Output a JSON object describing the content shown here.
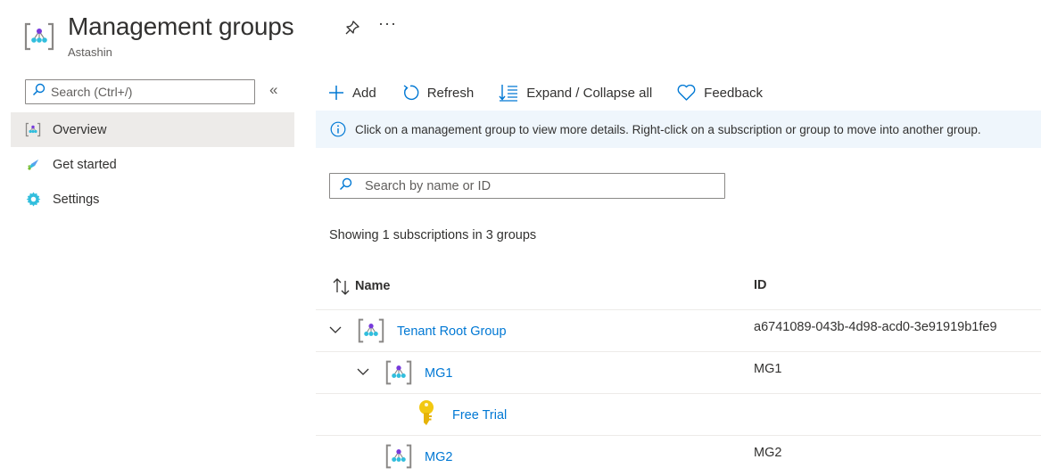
{
  "header": {
    "title": "Management groups",
    "subtitle": "Astashin",
    "more_label": "···",
    "icons": [
      "management-groups-icon",
      "pin-icon",
      "more-icon"
    ]
  },
  "sidebar": {
    "search_placeholder": "Search (Ctrl+/)",
    "collapse_label": "«",
    "items": [
      {
        "label": "Overview",
        "icon": "management-groups-icon",
        "active": true
      },
      {
        "label": "Get started",
        "icon": "rocket-icon",
        "active": false
      },
      {
        "label": "Settings",
        "icon": "gear-icon",
        "active": false
      }
    ]
  },
  "toolbar": {
    "add_label": "Add",
    "refresh_label": "Refresh",
    "expand_label": "Expand / Collapse all",
    "feedback_label": "Feedback"
  },
  "banner": {
    "text": "Click on a management group to view more details. Right-click on a subscription or group to move into another group."
  },
  "search": {
    "placeholder": "Search by name or ID"
  },
  "summary": {
    "text": "Showing 1 subscriptions in 3 groups"
  },
  "table": {
    "columns": {
      "name": "Name",
      "id": "ID"
    },
    "rows": [
      {
        "name": "Tenant Root Group",
        "id": "a6741089-043b-4d98-acd0-3e91919b1fe9",
        "type": "management-group",
        "expanded": true,
        "depth": 0
      },
      {
        "name": "MG1",
        "id": "MG1",
        "type": "management-group",
        "expanded": true,
        "depth": 1
      },
      {
        "name": "Free Trial",
        "id": "",
        "type": "subscription",
        "depth": 2
      },
      {
        "name": "MG2",
        "id": "MG2",
        "type": "management-group",
        "depth": 1
      }
    ]
  },
  "colors": {
    "accent": "#0078d4",
    "banner_bg": "#eff6fc",
    "active_nav_bg": "#edebe9",
    "key_yellow": "#f2c811",
    "mg_purple": "#773adc",
    "mg_teal": "#32bedd"
  }
}
